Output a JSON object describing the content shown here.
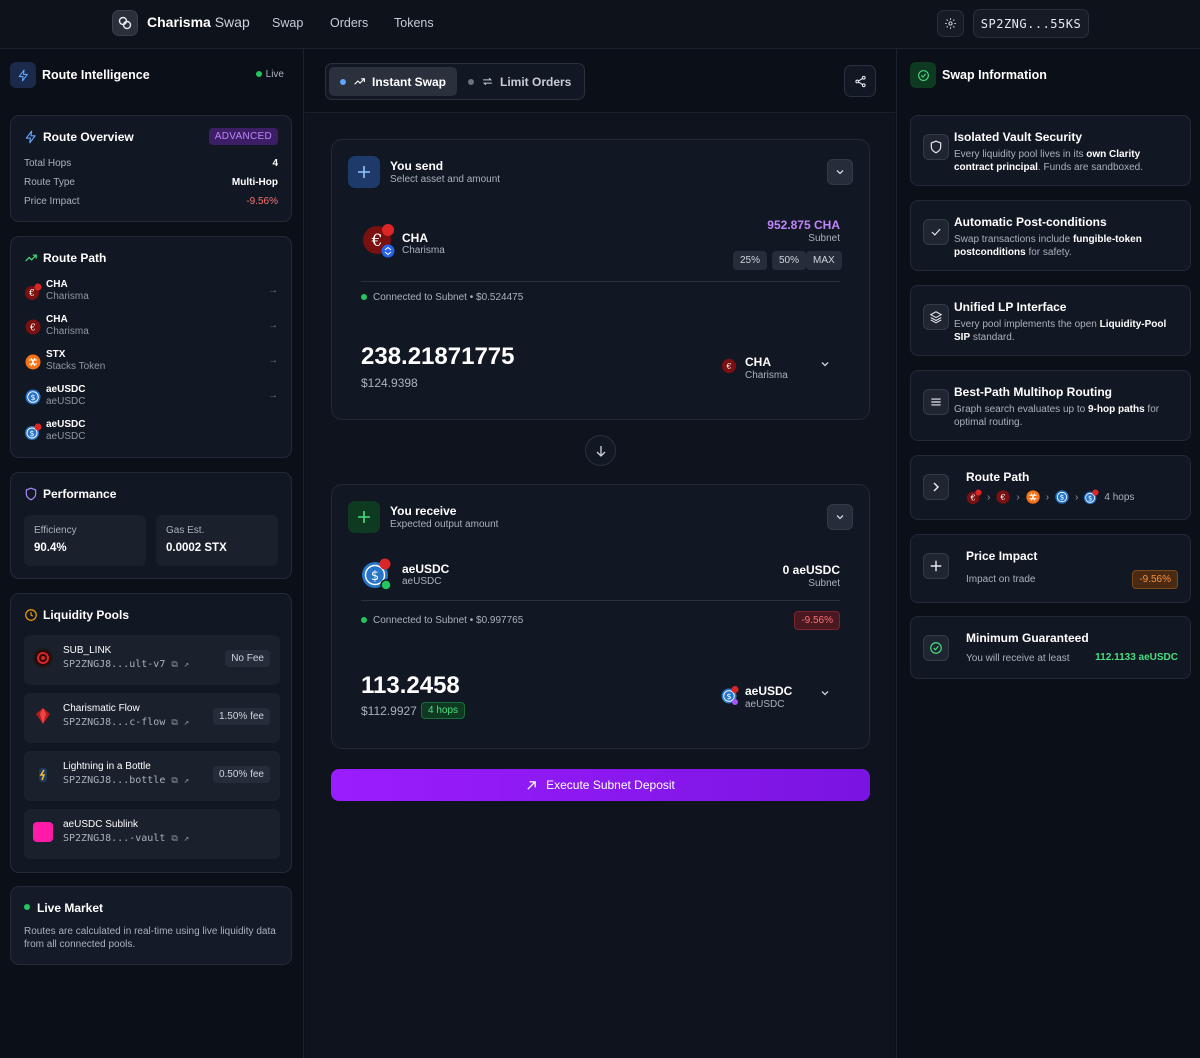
{
  "nav": {
    "brand_bold": "Charisma",
    "brand_thin": "Swap",
    "links": [
      "Swap",
      "Orders",
      "Tokens"
    ],
    "wallet": "SP2ZNG...55KS"
  },
  "left": {
    "header_title": "Route Intelligence",
    "live_label": "Live",
    "overview": {
      "title": "Route Overview",
      "badge": "ADVANCED",
      "rows": [
        {
          "k": "Total Hops",
          "v": "4"
        },
        {
          "k": "Route Type",
          "v": "Multi-Hop"
        },
        {
          "k": "Price Impact",
          "v": "-9.56%"
        }
      ]
    },
    "route_path": {
      "title": "Route Path",
      "items": [
        {
          "name": "CHA",
          "sub": "Charisma"
        },
        {
          "name": "CHA",
          "sub": "Charisma"
        },
        {
          "name": "STX",
          "sub": "Stacks Token"
        },
        {
          "name": "aeUSDC",
          "sub": "aeUSDC"
        },
        {
          "name": "aeUSDC",
          "sub": "aeUSDC"
        }
      ]
    },
    "performance": {
      "title": "Performance",
      "efficiency_label": "Efficiency",
      "efficiency_value": "90.4%",
      "gas_label": "Gas Est.",
      "gas_value": "0.0002 STX"
    },
    "pools": {
      "title": "Liquidity Pools",
      "items": [
        {
          "name": "SUB_LINK",
          "addr": "SP2ZNGJ8...ult-v7",
          "fee": "No Fee"
        },
        {
          "name": "Charismatic Flow",
          "addr": "SP2ZNGJ8...c-flow",
          "fee": "1.50% fee"
        },
        {
          "name": "Lightning in a Bottle",
          "addr": "SP2ZNGJ8...bottle",
          "fee": "0.50% fee"
        },
        {
          "name": "aeUSDC Sublink",
          "addr": "SP2ZNGJ8...-vault",
          "fee": ""
        }
      ]
    },
    "live_market": {
      "title": "Live Market",
      "text": "Routes are calculated in real-time using live liquidity data from all connected pools."
    }
  },
  "center": {
    "tabs": [
      "Instant Swap",
      "Limit Orders"
    ],
    "send": {
      "title": "You send",
      "subtitle": "Select asset and amount",
      "token_name": "CHA",
      "token_sub": "Charisma",
      "balance": "952.875 CHA",
      "balance_sub": "Subnet",
      "pct": [
        "25%",
        "50%",
        "MAX"
      ],
      "connected": "Connected to Subnet • $0.524475",
      "amount": "238.21871775",
      "amount_usd": "$124.9398",
      "sel_name": "CHA",
      "sel_sub": "Charisma"
    },
    "receive": {
      "title": "You receive",
      "subtitle": "Expected output amount",
      "token_name": "aeUSDC",
      "token_sub": "aeUSDC",
      "balance": "0 aeUSDC",
      "balance_sub": "Subnet",
      "connected": "Connected to Subnet • $0.997765",
      "impact": "-9.56%",
      "amount": "113.2458",
      "amount_usd": "$112.9927",
      "hops": "4 hops",
      "sel_name": "aeUSDC",
      "sel_sub": "aeUSDC"
    },
    "execute_label": "Execute Subnet Deposit"
  },
  "right": {
    "header_title": "Swap Information",
    "vault": {
      "title": "Isolated Vault Security",
      "pre": "Every liquidity pool lives in its ",
      "bold": "own Clarity contract principal",
      "post": ". Funds are sandboxed."
    },
    "postcond": {
      "title": "Automatic Post-conditions",
      "pre": "Swap transactions include ",
      "bold": "fungible-token postconditions",
      "post": " for safety."
    },
    "lp": {
      "title": "Unified LP Interface",
      "pre": "Every pool implements the open ",
      "bold": "Liquidity-Pool SIP",
      "post": " standard."
    },
    "routing": {
      "title": "Best-Path Multihop Routing",
      "pre": "Graph search evaluates up to ",
      "bold": "9-hop paths",
      "post": " for optimal routing."
    },
    "route_path": {
      "title": "Route Path",
      "hops": "4 hops"
    },
    "price_impact": {
      "title": "Price Impact",
      "sub": "Impact on trade",
      "value": "-9.56%"
    },
    "minimum": {
      "title": "Minimum Guaranteed",
      "sub": "You will receive at least",
      "value": "112.1133 aeUSDC"
    }
  }
}
